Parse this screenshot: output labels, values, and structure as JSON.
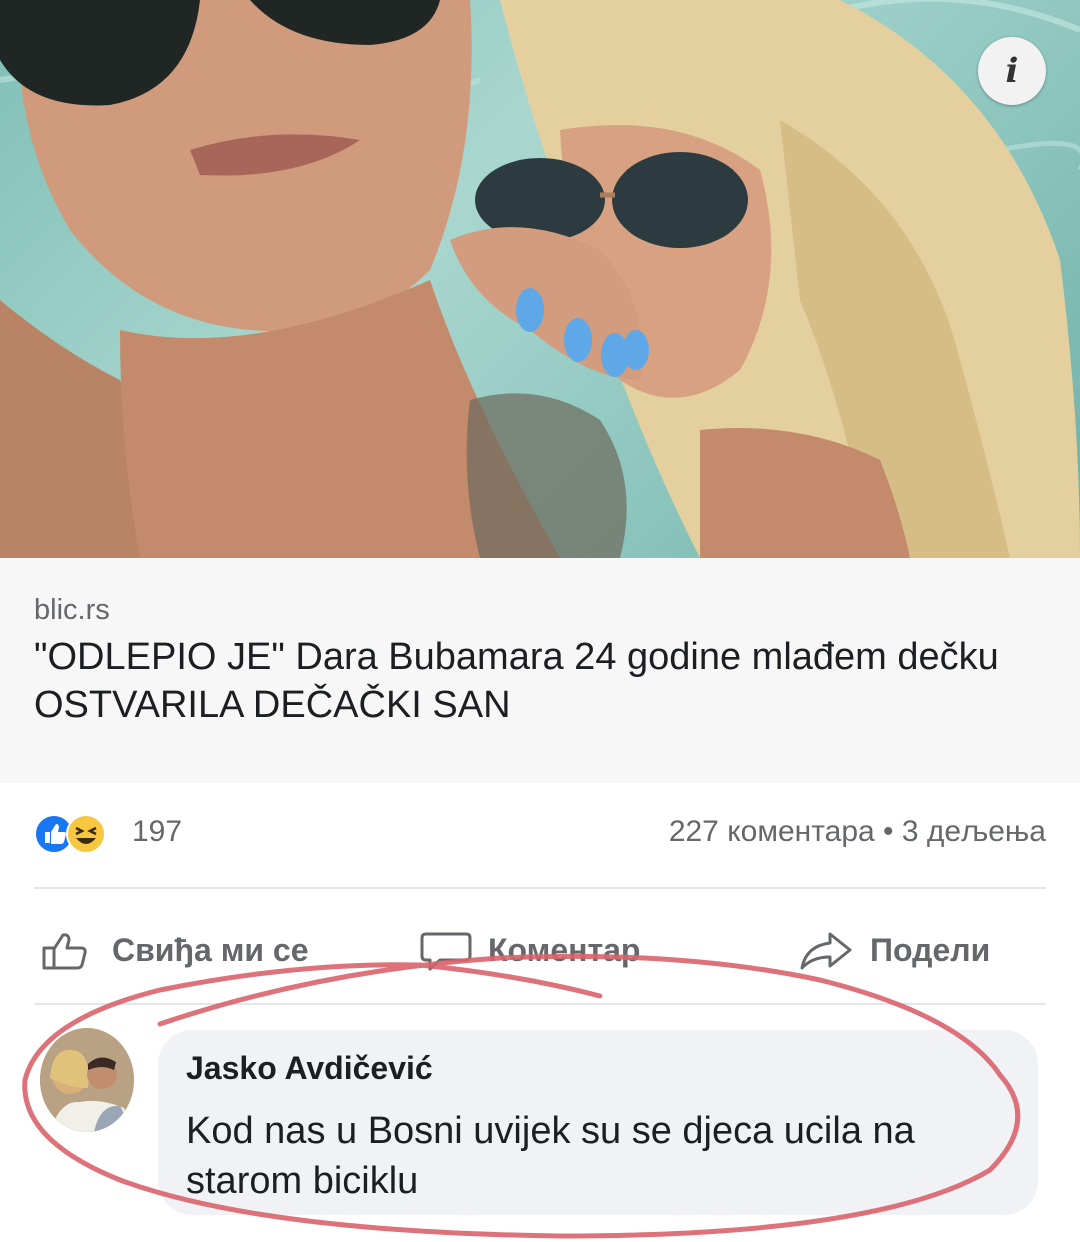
{
  "post": {
    "info_icon": "info-icon",
    "source": "blic.rs",
    "headline": "\"ODLEPIO JE\" Dara Bubamara 24 godine mlađem dečku OSTVARILA DEČAČKI SAN"
  },
  "stats": {
    "reactions": [
      "like-icon",
      "haha-icon"
    ],
    "reaction_count": "197",
    "comments_shares": "227 коментара • 3 дељења"
  },
  "actions": {
    "like_label": "Свиђа ми се",
    "comment_label": "Коментар",
    "share_label": "Подели"
  },
  "comment": {
    "author": "Jasko Avdičević",
    "text": "Kod nas u Bosni uvijek su se djeca ucila na starom biciklu"
  },
  "colors": {
    "facebook_blue": "#1877f2",
    "annotation_red": "#d9636b",
    "secondary_text": "#65676b"
  }
}
